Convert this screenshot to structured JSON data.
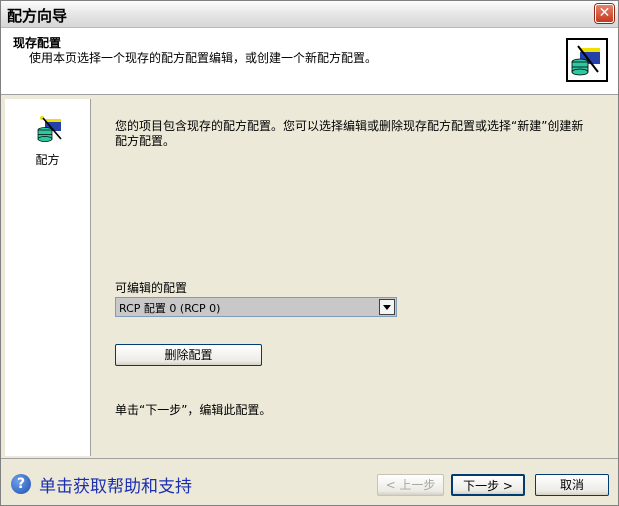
{
  "window": {
    "title": "配方向导",
    "close_glyph": "✕"
  },
  "header": {
    "title": "现存配置",
    "subtitle": "使用本页选择一个现存的配方配置编辑，或创建一个新配方配置。",
    "icon": "recipe-wizard-icon"
  },
  "sidebar": {
    "icon": "recipe-icon",
    "label": "配方"
  },
  "main": {
    "intro": "您的项目包含现存的配方配置。您可以选择编辑或删除现存配方配置或选择“新建”创建新配方配置。",
    "dropdown_label": "可编辑的配置",
    "dropdown_value": "RCP 配置 0 (RCP 0)",
    "delete_button": "删除配置",
    "hint": "单击“下一步”，编辑此配置。"
  },
  "footer": {
    "help_icon_glyph": "?",
    "help_link": "单击获取帮助和支持",
    "back_button": "< 上一步",
    "next_button": "下一步 >",
    "cancel_button": "取消"
  },
  "colors": {
    "header_bg": "#ffffff",
    "content_bg": "#ece9d8",
    "button_border": "#003c74",
    "help_link": "#1c2fb0",
    "close_button": "#c6381c"
  }
}
